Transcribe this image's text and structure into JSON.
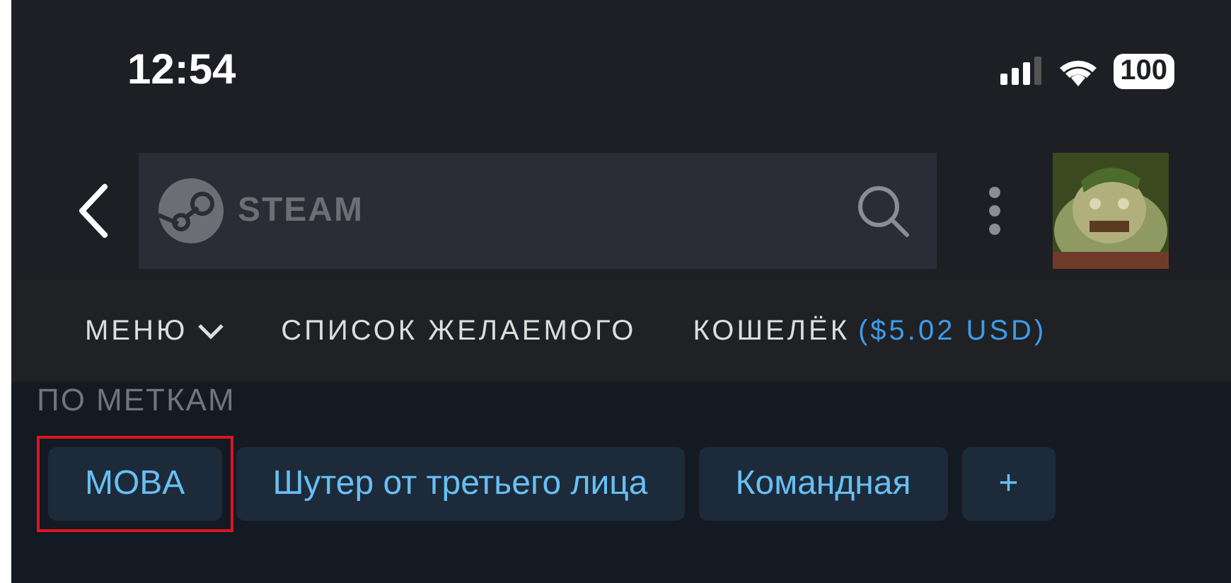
{
  "status_bar": {
    "time": "12:54",
    "battery": "100"
  },
  "header": {
    "search": {
      "placeholder": "STEAM"
    }
  },
  "nav": {
    "items": [
      {
        "label": "МЕНЮ",
        "dropdown": true
      },
      {
        "label": "СПИСОК ЖЕЛАЕМОГО",
        "dropdown": false
      },
      {
        "label": "КОШЕЛЁК",
        "balance": "($5.02 USD)",
        "dropdown": false
      }
    ]
  },
  "tags_section": {
    "heading": "ПО МЕТКАМ",
    "tags": [
      {
        "label": "MOBA",
        "highlighted": true
      },
      {
        "label": "Шутер от третьего лица",
        "highlighted": false
      },
      {
        "label": "Командная",
        "highlighted": false
      },
      {
        "label": "+",
        "highlighted": false
      }
    ]
  }
}
